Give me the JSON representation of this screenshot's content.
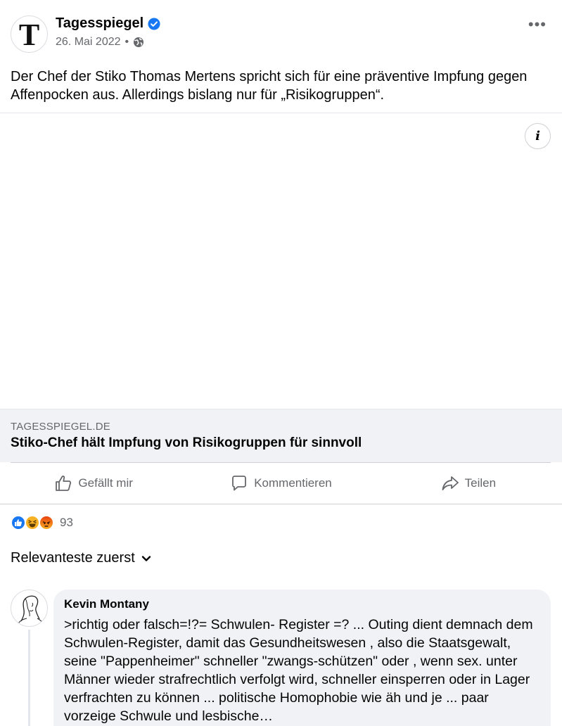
{
  "post": {
    "page_name": "Tagesspiegel",
    "avatar_letter": "T",
    "date": "26. Mai 2022",
    "separator": "•",
    "privacy_icon": "globe-icon",
    "more_label": "•••",
    "text": "Der Chef der Stiko Thomas Mertens spricht sich für eine präventive Impfung gegen Affenpocken aus. Allerdings bislang nur für „Risikogruppen“."
  },
  "media": {
    "info_label": "i"
  },
  "link": {
    "domain": "TAGESSPIEGEL.DE",
    "title": "Stiko-Chef hält Impfung von Risikogruppen für sinnvoll"
  },
  "actions": {
    "like": "Gefällt mir",
    "comment": "Kommentieren",
    "share": "Teilen"
  },
  "reactions": {
    "icons": [
      "like-icon",
      "haha-icon",
      "angry-icon"
    ],
    "count": "93"
  },
  "sort": {
    "label": "Relevanteste zuerst"
  },
  "comments": [
    {
      "author": "Kevin Montany",
      "text": ">richtig oder falsch=!?= Schwulen- Register =? ... Outing dient demnach dem Schwulen-Register, damit das Gesundheitswesen , also die Staatsgewalt, seine \"Pappenheimer\" schneller \"zwangs-schützen\" oder , wenn sex. unter Männer wieder strafrechtlich verfolgt wird, schneller einsperren oder in Lager verfrachten zu können  ... politische Homophobie wie äh und je ... paar vorzeige Schwule und lesbische…"
    }
  ],
  "colors": {
    "accent": "#1877f2",
    "muted": "#65676b",
    "bubble": "#f0f2f5"
  }
}
